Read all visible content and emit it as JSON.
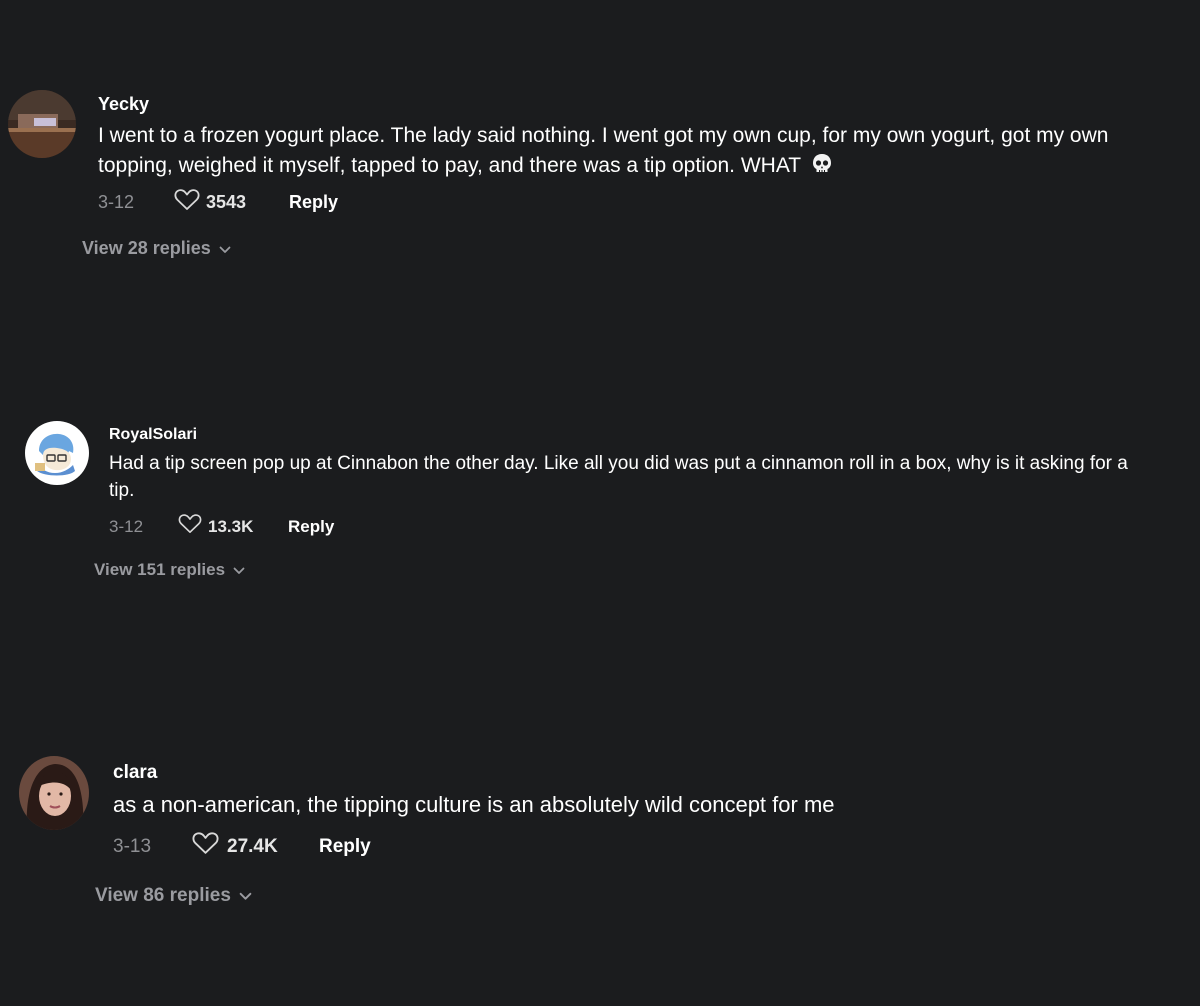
{
  "comments": [
    {
      "username": "Yecky",
      "text": "I went to a frozen yogurt place. The lady said nothing. I went got my own cup, for my own yogurt, got my own topping, weighed it myself, tapped to pay, and there was a tip option. WHAT",
      "emoji": "skull-icon",
      "date": "3-12",
      "likes": "3543",
      "reply_label": "Reply",
      "view_replies": "View 28 replies",
      "avatar": "photo-avatar-icon"
    },
    {
      "username": "RoyalSolari",
      "text": "Had a tip screen pop up at Cinnabon the other day. Like all you did was put a cinnamon roll in a box, why is it asking for a tip.",
      "date": "3-12",
      "likes": "13.3K",
      "reply_label": "Reply",
      "view_replies": "View 151 replies",
      "avatar": "cartoon-avatar-icon"
    },
    {
      "username": "clara",
      "text": "as a non-american, the tipping culture is an absolutely wild concept for me",
      "date": "3-13",
      "likes": "27.4K",
      "reply_label": "Reply",
      "view_replies": "View 86 replies",
      "avatar": "portrait-avatar-icon"
    }
  ]
}
